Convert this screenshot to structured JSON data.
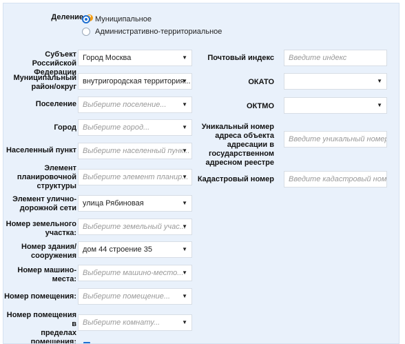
{
  "division": {
    "label": "Деление",
    "help_icon": "?",
    "options": [
      {
        "label": "Муниципальное",
        "selected": true
      },
      {
        "label": "Административно-территориальное",
        "selected": false
      }
    ]
  },
  "left_fields": [
    {
      "label_lines": [
        "Субъект Российской",
        "Федерации"
      ],
      "value": "Город Москва",
      "placeholder": "",
      "type": "select"
    },
    {
      "label_lines": [
        "Муниципальный",
        "район/округ"
      ],
      "value": "внутригородская территория...",
      "placeholder": "",
      "type": "select"
    },
    {
      "label_lines": [
        "Поселение"
      ],
      "value": "",
      "placeholder": "Выберите поселение...",
      "type": "select"
    },
    {
      "label_lines": [
        "Город"
      ],
      "value": "",
      "placeholder": "Выберите город...",
      "type": "select"
    },
    {
      "label_lines": [
        "Населенный пункт"
      ],
      "value": "",
      "placeholder": "Выберите населенный пунк...",
      "type": "select"
    },
    {
      "label_lines": [
        "Элемент",
        "планировочной",
        "структуры"
      ],
      "value": "",
      "placeholder": "Выберите элемент планир...",
      "type": "select"
    },
    {
      "label_lines": [
        "Элемент улично-",
        "дорожной сети"
      ],
      "value": "улица Рябиновая",
      "placeholder": "",
      "type": "select"
    },
    {
      "label_lines": [
        "Номер земельного",
        "участка:"
      ],
      "value": "",
      "placeholder": "Выберите земельный учас...",
      "type": "select"
    },
    {
      "label_lines": [
        "Номер здания/",
        "сооружения"
      ],
      "value": "дом 44 строение 35",
      "placeholder": "",
      "type": "select"
    },
    {
      "label_lines": [
        "Номер машино-",
        "места:"
      ],
      "value": "",
      "placeholder": "Выберите машино-место...",
      "type": "select"
    },
    {
      "label_lines": [
        "Номер помещения:"
      ],
      "value": "",
      "placeholder": "Выберите помещение...",
      "type": "select"
    },
    {
      "label_lines": [
        "Номер помещения в",
        "пределах",
        "помещения:"
      ],
      "value": "",
      "placeholder": "Выберите комнату...",
      "type": "select"
    }
  ],
  "right_fields": [
    {
      "label_lines": [
        "Почтовый индекс"
      ],
      "value": "",
      "placeholder": "Введите индекс",
      "type": "input"
    },
    {
      "label_lines": [
        "ОКАТО"
      ],
      "value": "",
      "placeholder": "",
      "type": "select"
    },
    {
      "label_lines": [
        "ОКТМО"
      ],
      "value": "",
      "placeholder": "",
      "type": "select"
    },
    {
      "label_lines": [
        "Уникальный номер",
        "адреса объекта",
        "адресации в",
        "государственном",
        "адресном реестре"
      ],
      "value": "",
      "placeholder": "Введите уникальный номер",
      "type": "input"
    },
    {
      "label_lines": [
        "Кадастровый номер"
      ],
      "value": "",
      "placeholder": "Введите кадастровый номер",
      "type": "input"
    }
  ],
  "caret_glyph": "▼",
  "accent_color": "#1d6fd1",
  "help_color": "#f39c12"
}
